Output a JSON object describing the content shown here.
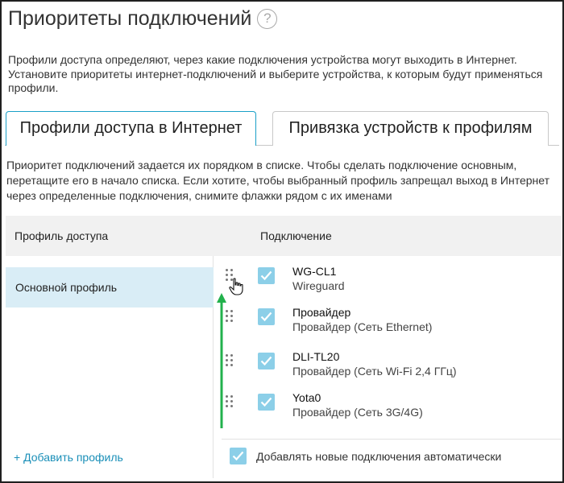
{
  "page": {
    "title": "Приоритеты подключений",
    "help_icon": "?",
    "description": "Профили доступа определяют, через какие подключения устройства могут выходить в Интернет. Установите приоритеты интернет-подключений и выберите устройства, к которым будут применяться профили."
  },
  "tabs": [
    {
      "label": "Профили доступа в Интернет",
      "active": true
    },
    {
      "label": "Привязка устройств к профилям",
      "active": false
    }
  ],
  "hint": "Приоритет подключений задается их порядком в списке. Чтобы сделать подключение основным, перетащите его в начало списка. Если хотите, чтобы выбранный профиль запрещал выход в Интернет через определенные подключения, снимите флажки рядом с их именами",
  "table": {
    "col_profile": "Профиль доступа",
    "col_connection": "Подключение"
  },
  "profiles": [
    {
      "label": "Основной профиль",
      "selected": true
    }
  ],
  "add_profile_label": "+ Добавить профиль",
  "connections": [
    {
      "name": "WG-CL1",
      "sub": "Wireguard",
      "checked": true
    },
    {
      "name": "Провайдер",
      "sub": "Провайдер (Сеть Ethernet)",
      "checked": true
    },
    {
      "name": "DLI-TL20",
      "sub": "Провайдер (Сеть Wi-Fi 2,4 ГГц)",
      "checked": true
    },
    {
      "name": "Yota0",
      "sub": "Провайдер (Сеть 3G/4G)",
      "checked": true
    }
  ],
  "auto_add": {
    "label": "Добавлять новые подключения автоматически",
    "checked": true
  },
  "colors": {
    "accent": "#1aa0c8",
    "checkbox": "#8ccfe8",
    "selected_row": "#d9edf6",
    "link": "#1a8fb8",
    "arrow": "#22b14c"
  }
}
